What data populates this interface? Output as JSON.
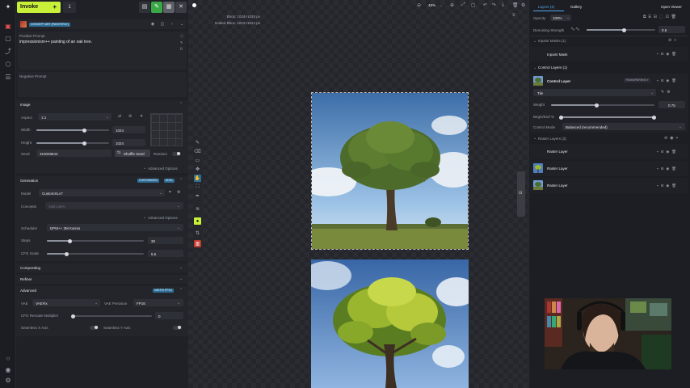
{
  "toolbar": {
    "invoke_label": "Invoke",
    "invoke_plus": "+",
    "count": "1",
    "btn_a": "▤",
    "btn_b": "✎",
    "btn_c": "▦",
    "btn_d": "✕"
  },
  "model_header": {
    "badge": "CONCEPT ART (PAINTERLY)"
  },
  "prompts": {
    "positive_label": "Positive Prompt",
    "positive_value": "impressionism++ painting of an oak tree.",
    "negative_label": "Negative Prompt"
  },
  "image": {
    "section_label": "Image",
    "aspect_label": "Aspect",
    "aspect_value": "1:1",
    "width_label": "Width",
    "width_value": "1024",
    "height_label": "Height",
    "height_value": "1024",
    "seed_label": "Seed",
    "seed_value": "310048643",
    "shuffle_label": "Shuffle Seed",
    "random_label": "Random",
    "advanced_label": "Advanced Options",
    "width_fraction": 0.66,
    "height_fraction": 0.66
  },
  "generation": {
    "section_label": "Generation",
    "badge_a": "CUSTOMIZED",
    "badge_b": "SDXL",
    "model_label": "Model",
    "model_value": "CustomXLv7",
    "concepts_label": "Concepts",
    "concepts_placeholder": "Add LoRA",
    "advanced_label": "Advanced Options",
    "scheduler_label": "Scheduler",
    "scheduler_value": "DPM++ 3M Karras",
    "steps_label": "Steps",
    "steps_value": "30",
    "cfg_label": "CFG Scale",
    "cfg_value": "5.5",
    "steps_fraction": 0.24,
    "cfg_fraction": 0.2
  },
  "compositing": {
    "section_label": "Compositing"
  },
  "refiner": {
    "section_label": "Refiner"
  },
  "advanced": {
    "section_label": "Advanced",
    "badge": "VAEFIX FP16",
    "vae_label": "VAE",
    "vae_value": "VAEFix",
    "vae_precision_label": "VAE Precision",
    "vae_precision_value": "FP16",
    "cfg_rescale_label": "CFG Rescale Multiplier",
    "cfg_rescale_value": "0",
    "seamless_x_label": "Seamless X Axis",
    "seamless_y_label": "Seamless Y Axis"
  },
  "canvas": {
    "bbox_label": "Bbox: 1024×1024 px",
    "scaled_bbox_label": "Scaled Bbox: 1024×1024 px",
    "zoom": "48%"
  },
  "right_panel": {
    "tab_layers": "Layers (4)",
    "tab_gallery": "Gallery",
    "open_viewer": "Open Viewer",
    "opacity_label": "Opacity",
    "opacity_value": "100%",
    "denoise_label": "Denoising Strength",
    "denoise_value": "0.6",
    "denoise_fraction": 0.55,
    "inpaint_header": "Inpaint Masks (1)",
    "inpaint_item": "Inpaint Mask",
    "control_header": "Control Layers (1)",
    "control_item": "Control Layer",
    "control_badge": "TRANSPARENCY",
    "control_model": "Tile",
    "weight_label": "Weight",
    "weight_value": "0.75",
    "weight_fraction": 0.44,
    "begin_end_label": "Begin/End %",
    "begin_fraction": 0.0,
    "end_fraction": 1.0,
    "control_mode_label": "Control Mode",
    "control_mode_value": "Balanced (recommended)",
    "raster_header": "Raster Layers (3)",
    "raster_items": [
      "Raster Layer",
      "Raster Layer",
      "Raster Layer"
    ]
  },
  "colors": {
    "accent": "#c9f039",
    "badge_blue": "#2f6e97",
    "panel": "#1f2127",
    "canvas": "#2a2c31"
  }
}
